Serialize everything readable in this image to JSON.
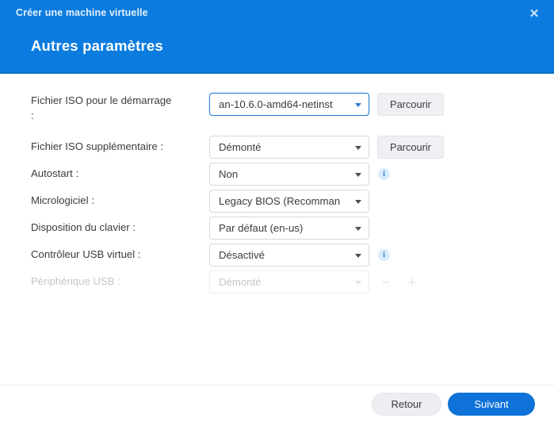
{
  "window": {
    "title": "Créer une machine virtuelle",
    "close_icon": "close-icon",
    "heading": "Autres paramètres",
    "header_color": "#0b7bdf",
    "accent_color": "#0e72d8"
  },
  "form": {
    "rows": [
      {
        "label": "Fichier ISO pour le démarrage :",
        "label_line1": "Fichier ISO pour le démarrage",
        "label_line2": ":",
        "value": "an-10.6.0-amd64-netinst",
        "focused": true,
        "disabled": false,
        "browse_label": "Parcourir",
        "has_info": false
      },
      {
        "label": "Fichier ISO supplémentaire :",
        "value": "Démonté",
        "focused": false,
        "disabled": false,
        "browse_label": "Parcourir",
        "has_info": false
      },
      {
        "label": "Autostart :",
        "value": "Non",
        "focused": false,
        "disabled": false,
        "has_info": true
      },
      {
        "label": "Micrologiciel :",
        "value": "Legacy BIOS (Recomman",
        "focused": false,
        "disabled": false,
        "has_info": false
      },
      {
        "label": "Disposition du clavier :",
        "value": "Par défaut (en-us)",
        "focused": false,
        "disabled": false,
        "has_info": false
      },
      {
        "label": "Contrôleur USB virtuel :",
        "value": "Désactivé",
        "focused": false,
        "disabled": false,
        "has_info": true
      },
      {
        "label": "Périphérique USB :",
        "value": "Démonté",
        "focused": false,
        "disabled": true,
        "has_info": false,
        "minus_label": "−",
        "plus_label": "+"
      }
    ]
  },
  "footer": {
    "back_label": "Retour",
    "next_label": "Suivant"
  }
}
